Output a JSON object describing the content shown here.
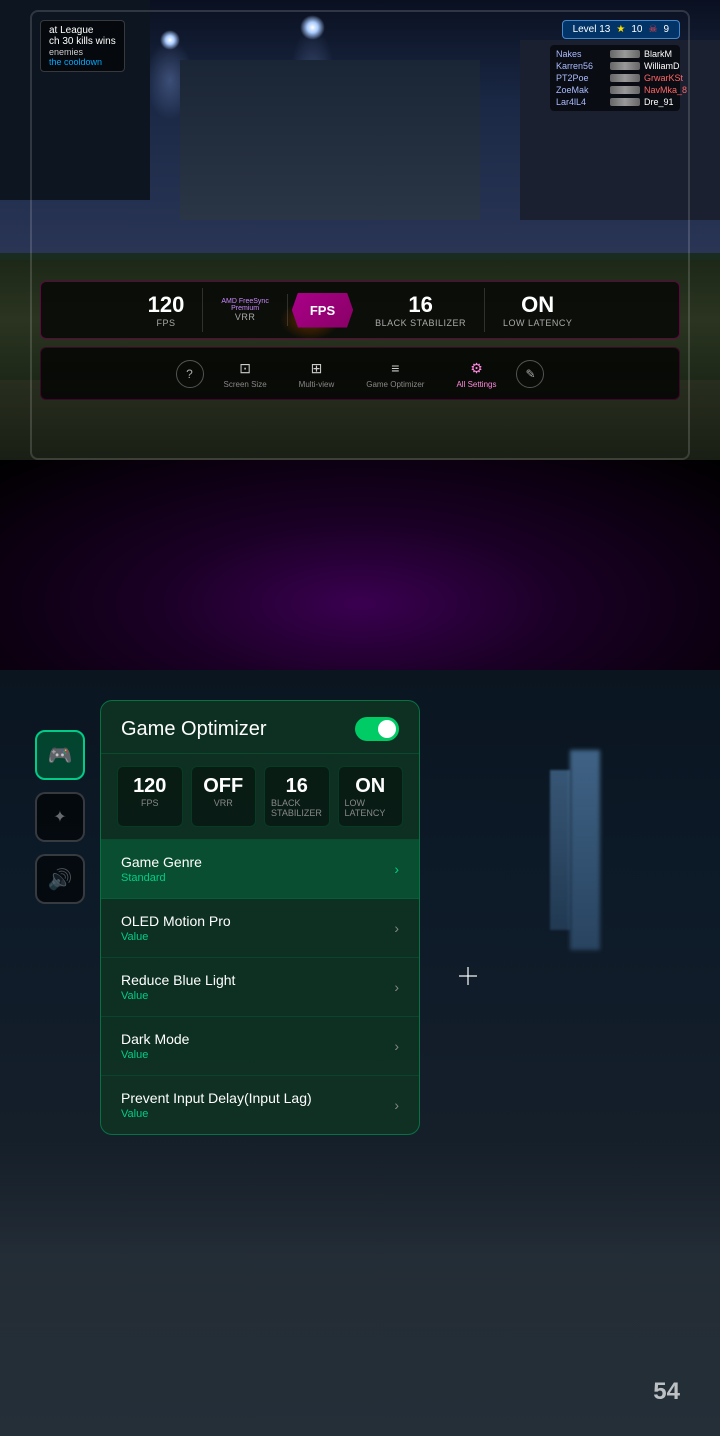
{
  "topSection": {
    "hud": {
      "leftText1": "at League",
      "leftText2": "ch 30 kills wins",
      "leftText3": "enemies",
      "leftText4": "the cooldown",
      "levelBadge": "Level 13",
      "starCount": "10",
      "skullCount": "9",
      "players": [
        {
          "name": "Nakes",
          "kills": "BlarkM",
          "killCount": ""
        },
        {
          "name": "Karren56",
          "kills": "WilliamD",
          "killCount": ""
        },
        {
          "name": "PT2Poe",
          "kills": "GrwarKSt",
          "killCount": ""
        },
        {
          "name": "ZoeMak",
          "kills": "NavMka_8",
          "killCount": ""
        },
        {
          "name": "Lar4lL4",
          "kills": "Dre_91",
          "killCount": ""
        }
      ]
    },
    "stats": [
      {
        "value": "120",
        "label": "FPS",
        "sublabel": ""
      },
      {
        "value": "FreeSync",
        "label": "VRR",
        "sublabel": "Premium"
      },
      {
        "value": "FPS",
        "label": "",
        "sublabel": ""
      },
      {
        "value": "16",
        "label": "Black Stabilizer",
        "sublabel": ""
      },
      {
        "value": "ON",
        "label": "Low Latency",
        "sublabel": ""
      }
    ],
    "menu": [
      {
        "icon": "?",
        "label": ""
      },
      {
        "icon": "⊡",
        "label": "Screen Size",
        "active": false
      },
      {
        "icon": "⊞",
        "label": "Multi-view",
        "active": false
      },
      {
        "icon": "≡",
        "label": "Game Optimizer",
        "active": false
      },
      {
        "icon": "⚙",
        "label": "All Settings",
        "active": true
      },
      {
        "icon": "✎",
        "label": ""
      }
    ]
  },
  "bottomSection": {
    "gameOptimizer": {
      "title": "Game Optimizer",
      "toggleOn": true,
      "stats": [
        {
          "value": "120",
          "label": "FPS"
        },
        {
          "value": "OFF",
          "label": "VRR"
        },
        {
          "value": "16",
          "label": "Black Stabilizer"
        },
        {
          "value": "ON",
          "label": "Low Latency"
        }
      ],
      "menuItems": [
        {
          "title": "Game Genre",
          "value": "Standard",
          "active": true
        },
        {
          "title": "OLED Motion Pro",
          "value": "Value",
          "active": false
        },
        {
          "title": "Reduce Blue Light",
          "value": "Value",
          "active": false
        },
        {
          "title": "Dark Mode",
          "value": "Value",
          "active": false
        },
        {
          "title": "Prevent Input Delay(Input Lag)",
          "value": "Value",
          "active": false
        }
      ]
    },
    "sidebar": [
      {
        "icon": "🎮",
        "label": "gamepad",
        "active": true
      },
      {
        "icon": "✦",
        "label": "effects",
        "active": false
      },
      {
        "icon": "🔊",
        "label": "audio",
        "active": false
      }
    ],
    "ammo": "54"
  }
}
